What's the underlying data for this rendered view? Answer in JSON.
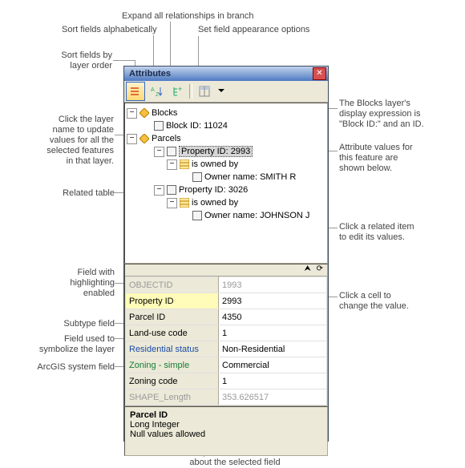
{
  "title": "Attributes",
  "toolbar": {
    "btns": [
      "layer-order-icon",
      "sort-az-icon",
      "expand-tree-icon",
      "sep",
      "options-icon",
      "dropdown-icon"
    ]
  },
  "tree": {
    "blocks": {
      "label": "Blocks",
      "child": "Block ID: 11024"
    },
    "parcels": {
      "label": "Parcels",
      "items": [
        {
          "pid": "Property ID: 2993",
          "rel": "is owned by",
          "owner": "Owner name: SMITH R",
          "sel": true
        },
        {
          "pid": "Property ID: 3026",
          "rel": "is owned by",
          "owner": "Owner name: JOHNSON J"
        }
      ]
    }
  },
  "grid": [
    {
      "f": "OBJECTID",
      "v": "1993",
      "cls": "sys"
    },
    {
      "f": "Property ID",
      "v": "2993",
      "cls": "hl"
    },
    {
      "f": "Parcel ID",
      "v": "4350",
      "cls": ""
    },
    {
      "f": "Land-use code",
      "v": "1",
      "cls": ""
    },
    {
      "f": "Residential status",
      "v": "Non-Residential",
      "cls": "sub"
    },
    {
      "f": "Zoning - simple",
      "v": "Commercial",
      "cls": "sym"
    },
    {
      "f": "Zoning code",
      "v": "1",
      "cls": ""
    },
    {
      "f": "SHAPE_Length",
      "v": "353.626517",
      "cls": "sys"
    }
  ],
  "info": {
    "title": "Parcel ID",
    "line1": "Long Integer",
    "line2": "Null values allowed"
  },
  "callouts": {
    "c1": "Sort fields by\nlayer order",
    "c2": "Sort fields alphabetically",
    "c3": "Expand all relationships in branch",
    "c4": "Set field appearance options",
    "c5": "Click the layer\nname to update\nvalues for all the\nselected features\nin that layer.",
    "c6": "Related table",
    "c7": "Field with\nhighlighting\nenabled",
    "c8": "Subtype field",
    "c9": "Field used to\nsymbolize the layer",
    "c10": "ArcGIS system field",
    "c11": "The Blocks layer's\ndisplay expression is\n\"Block ID:\" and an ID.",
    "c12": "Attribute values for\nthis feature are\nshown below.",
    "c13": "Click a related item\nto edit its values.",
    "c14": "Click a cell to\nchange the value.",
    "c15": "System information\nabout the selected field"
  },
  "chart_data": {
    "type": "table",
    "title": "Attributes",
    "rows": [
      {
        "field": "OBJECTID",
        "value": 1993,
        "kind": "system"
      },
      {
        "field": "Property ID",
        "value": 2993,
        "kind": "highlighted"
      },
      {
        "field": "Parcel ID",
        "value": 4350,
        "kind": "normal"
      },
      {
        "field": "Land-use code",
        "value": 1,
        "kind": "normal"
      },
      {
        "field": "Residential status",
        "value": "Non-Residential",
        "kind": "subtype"
      },
      {
        "field": "Zoning - simple",
        "value": "Commercial",
        "kind": "symbology"
      },
      {
        "field": "Zoning code",
        "value": 1,
        "kind": "normal"
      },
      {
        "field": "SHAPE_Length",
        "value": 353.626517,
        "kind": "system"
      }
    ]
  }
}
